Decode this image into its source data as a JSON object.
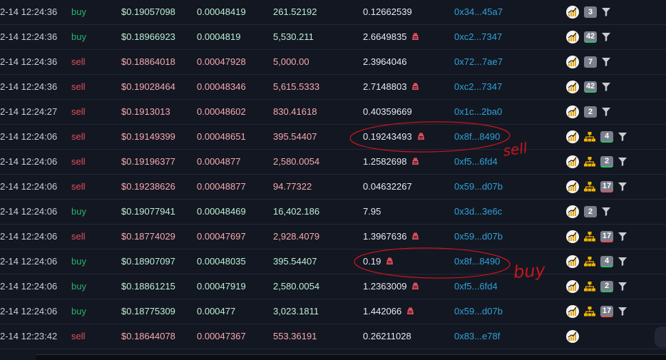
{
  "trades": [
    {
      "time": "2-14 12:24:36",
      "side": "buy",
      "price": "$0.19057098",
      "price_base": "0.00048419",
      "amount": "261.52192",
      "total": "0.12662539",
      "whale": false,
      "maker": "0x34...45a7",
      "tree": false,
      "badge": "3",
      "badge_style": "plain",
      "filter": true
    },
    {
      "time": "2-14 12:24:36",
      "side": "buy",
      "price": "$0.18966923",
      "price_base": "0.0004819",
      "amount": "5,530.211",
      "total": "2.6649835",
      "whale": true,
      "maker": "0xc2...7347",
      "tree": false,
      "badge": "42",
      "badge_style": "green",
      "filter": true
    },
    {
      "time": "2-14 12:24:36",
      "side": "sell",
      "price": "$0.18864018",
      "price_base": "0.00047928",
      "amount": "5,000.00",
      "total": "2.3964046",
      "whale": false,
      "maker": "0x72...7ae7",
      "tree": false,
      "badge": "7",
      "badge_style": "plain",
      "filter": true
    },
    {
      "time": "2-14 12:24:36",
      "side": "sell",
      "price": "$0.19028464",
      "price_base": "0.00048346",
      "amount": "5,615.5333",
      "total": "2.7148803",
      "whale": true,
      "maker": "0xc2...7347",
      "tree": false,
      "badge": "42",
      "badge_style": "green",
      "filter": true
    },
    {
      "time": "2-14 12:24:27",
      "side": "sell",
      "price": "$0.1913013",
      "price_base": "0.00048602",
      "amount": "830.41618",
      "total": "0.40359669",
      "whale": false,
      "maker": "0x1c...2ba0",
      "tree": false,
      "badge": "2",
      "badge_style": "plain",
      "filter": true
    },
    {
      "time": "2-14 12:24:06",
      "side": "sell",
      "price": "$0.19149399",
      "price_base": "0.00048651",
      "amount": "395.54407",
      "total": "0.19243493",
      "whale": true,
      "maker": "0x8f...8490",
      "tree": true,
      "badge": "4",
      "badge_style": "green",
      "filter": true
    },
    {
      "time": "2-14 12:24:06",
      "side": "sell",
      "price": "$0.19196377",
      "price_base": "0.0004877",
      "amount": "2,580.0054",
      "total": "1.2582698",
      "whale": true,
      "maker": "0xf5...6fd4",
      "tree": true,
      "badge": "2",
      "badge_style": "green",
      "filter": true
    },
    {
      "time": "2-14 12:24:06",
      "side": "sell",
      "price": "$0.19238626",
      "price_base": "0.00048877",
      "amount": "94.77322",
      "total": "0.04632267",
      "whale": false,
      "maker": "0x59...d07b",
      "tree": true,
      "badge": "17",
      "badge_style": "red",
      "filter": true
    },
    {
      "time": "2-14 12:24:06",
      "side": "buy",
      "price": "$0.19077941",
      "price_base": "0.00048469",
      "amount": "16,402.186",
      "total": "7.95",
      "whale": false,
      "maker": "0x3d...3e6c",
      "tree": false,
      "badge": "2",
      "badge_style": "plain",
      "filter": true
    },
    {
      "time": "2-14 12:24:06",
      "side": "sell",
      "price": "$0.18774029",
      "price_base": "0.00047697",
      "amount": "2,928.4079",
      "total": "1.3967636",
      "whale": true,
      "maker": "0x59...d07b",
      "tree": true,
      "badge": "17",
      "badge_style": "red",
      "filter": true
    },
    {
      "time": "2-14 12:24:06",
      "side": "buy",
      "price": "$0.18907097",
      "price_base": "0.00048035",
      "amount": "395.54407",
      "total": "0.19",
      "whale": true,
      "maker": "0x8f...8490",
      "tree": true,
      "badge": "4",
      "badge_style": "green",
      "filter": true
    },
    {
      "time": "2-14 12:24:06",
      "side": "buy",
      "price": "$0.18861215",
      "price_base": "0.00047919",
      "amount": "2,580.0054",
      "total": "1.2363009",
      "whale": true,
      "maker": "0xf5...6fd4",
      "tree": true,
      "badge": "2",
      "badge_style": "green",
      "filter": true
    },
    {
      "time": "2-14 12:24:06",
      "side": "buy",
      "price": "$0.18775309",
      "price_base": "0.000477",
      "amount": "3,023.1811",
      "total": "1.442066",
      "whale": true,
      "maker": "0x59...d07b",
      "tree": true,
      "badge": "17",
      "badge_style": "red",
      "filter": true
    },
    {
      "time": "2-14 12:23:42",
      "side": "sell",
      "price": "$0.18644078",
      "price_base": "0.00047367",
      "amount": "553.36191",
      "total": "0.26211028",
      "whale": false,
      "maker": "0x83...e78f",
      "tree": false,
      "badge": "",
      "badge_style": "none",
      "filter": false
    }
  ],
  "annotations": {
    "sell_note": "sell",
    "buy_note": "buy",
    "color": "#c8151b"
  },
  "colors": {
    "background": "#131722",
    "buy": "#26b36b",
    "sell": "#e0505a",
    "link": "#2fa2d8"
  }
}
